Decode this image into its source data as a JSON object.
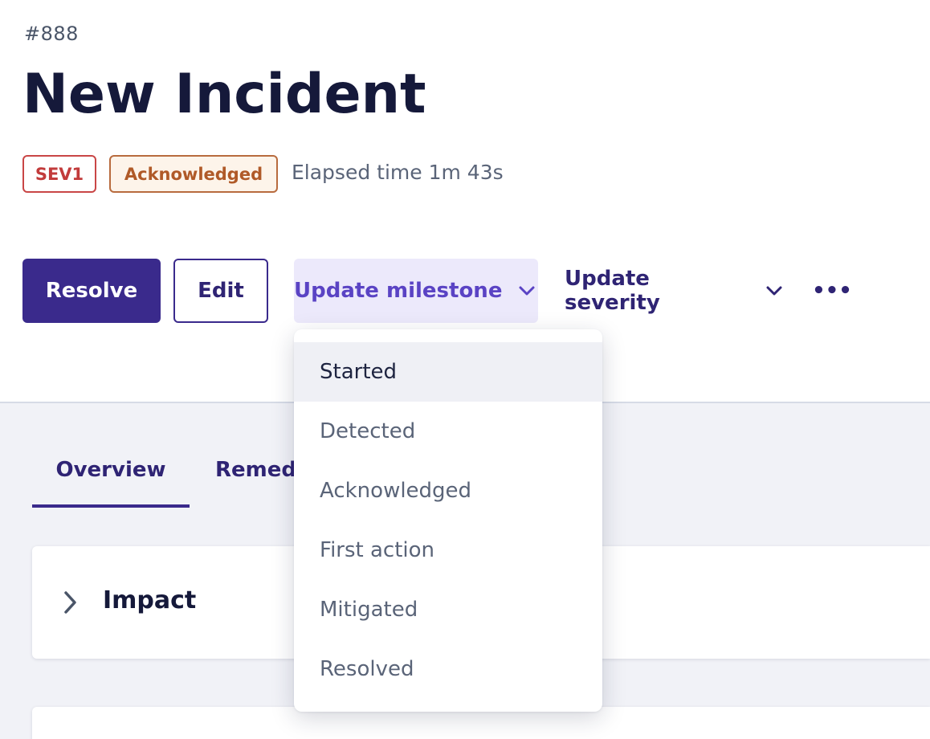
{
  "incident": {
    "id": "#888",
    "title": "New Incident",
    "severity_badge": "SEV1",
    "status_badge": "Acknowledged",
    "elapsed": "Elapsed time 1m 43s"
  },
  "actions": {
    "resolve": "Resolve",
    "edit": "Edit",
    "update_milestone": "Update milestone",
    "update_severity": "Update severity",
    "more": "•••"
  },
  "milestone_menu": {
    "items": [
      {
        "label": "Started",
        "active": true
      },
      {
        "label": "Detected"
      },
      {
        "label": "Acknowledged"
      },
      {
        "label": "First action"
      },
      {
        "label": "Mitigated"
      },
      {
        "label": "Resolved"
      }
    ]
  },
  "tabs": [
    {
      "label": "Overview",
      "active": true
    },
    {
      "label": "Remed"
    }
  ],
  "sections": {
    "impact_title": "Impact"
  },
  "colors": {
    "primary": "#3a2a8c",
    "severity": "#c23b3b",
    "status": "#b05a28",
    "milestone_bg": "#ece9fb"
  }
}
